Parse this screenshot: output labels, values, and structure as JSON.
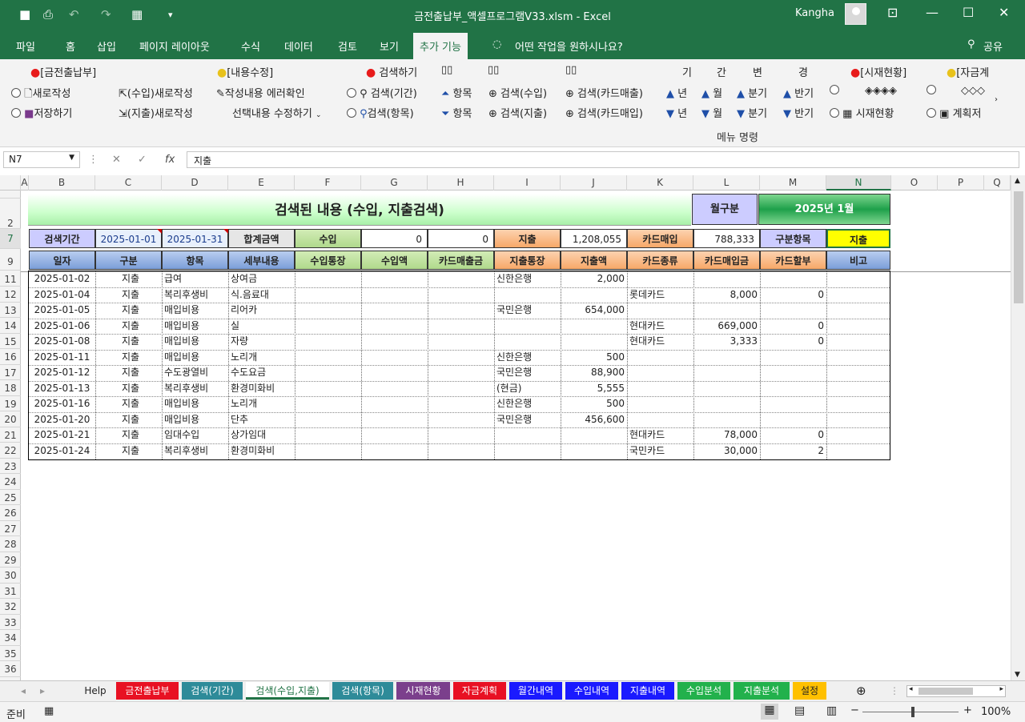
{
  "window": {
    "title": "금전출납부_액셀프로그램V33.xlsm  -  Excel",
    "user": "Kangha"
  },
  "ribbon_tabs": [
    "파일",
    "홈",
    "삽입",
    "페이지 레이아웃",
    "수식",
    "데이터",
    "검토",
    "보기",
    "추가 기능",
    "어떤 작업을 원하시나요?",
    "공유"
  ],
  "ribbon": {
    "group1_title": "[금전출납부]",
    "new": "새로작성",
    "save": "저장하기",
    "income_new": "(수입)새로작성",
    "expense_new": "(지출)새로작성",
    "group2_title": "[내용수정]",
    "error_check": "작성내용 에러확인",
    "edit_selected": "선택내용 수정하기",
    "search_title": "검색하기",
    "search_period": "검색(기간)",
    "search_item": "검색(항목)",
    "item_up": "항목",
    "item_down": "항목",
    "search_income": "검색(수입)",
    "search_expense": "검색(지출)",
    "search_card_sales": "검색(카드매출)",
    "search_card_buy": "검색(카드매입)",
    "period_header": [
      "기",
      "간",
      "변",
      "경"
    ],
    "year": "년",
    "month": "월",
    "quarter": "분기",
    "half": "반기",
    "status_title": "[시재현황]",
    "diamonds": "◈◈◈◈",
    "status": "시재현황",
    "plan_title": "[자금계",
    "diamonds2": "◇◇◇",
    "plan": "계획저",
    "menu_label": "메뉴 명령"
  },
  "formula_bar": {
    "name_box": "N7",
    "formula": "지출"
  },
  "columns": [
    "A",
    "B",
    "C",
    "D",
    "E",
    "F",
    "G",
    "H",
    "I",
    "J",
    "K",
    "L",
    "M",
    "N",
    "O",
    "P",
    "Q"
  ],
  "rows": [
    "1",
    "2",
    "7",
    "9",
    "11",
    "12",
    "13",
    "14",
    "15",
    "16",
    "17",
    "18",
    "19",
    "20",
    "21",
    "22",
    "23",
    "24",
    "25",
    "26",
    "27",
    "28",
    "29",
    "30",
    "31",
    "32",
    "33",
    "34",
    "35",
    "36"
  ],
  "sheet": {
    "title": "검색된 내용 (수입, 지출검색)",
    "month_label": "월구분",
    "month_value": "2025년 1월",
    "search_period_label": "검색기간",
    "date_from": "2025-01-01",
    "date_to": "2025-01-31",
    "total_label": "합계금액",
    "income_label": "수입",
    "income_value": "0",
    "income_value2": "0",
    "expense_label": "지출",
    "expense_value": "1,208,055",
    "card_buy_label": "카드매입",
    "card_buy_value": "788,333",
    "category_label": "구분항목",
    "category_value": "지출",
    "headers": [
      "일자",
      "구분",
      "항목",
      "세부내용",
      "수입통장",
      "수입액",
      "카드매출금",
      "지출통장",
      "지출액",
      "카드종류",
      "카드매입금",
      "카드할부",
      "비고"
    ],
    "data": [
      [
        "2025-01-02",
        "지출",
        "급여",
        "상여금",
        "",
        "",
        "",
        "신한은행",
        "2,000",
        "",
        "",
        "",
        ""
      ],
      [
        "2025-01-04",
        "지출",
        "복리후생비",
        "식.음료대",
        "",
        "",
        "",
        "",
        "",
        "롯데카드",
        "8,000",
        "0",
        ""
      ],
      [
        "2025-01-05",
        "지출",
        "매입비용",
        "리어카",
        "",
        "",
        "",
        "국민은행",
        "654,000",
        "",
        "",
        "",
        ""
      ],
      [
        "2025-01-06",
        "지출",
        "매입비용",
        "실",
        "",
        "",
        "",
        "",
        "",
        "현대카드",
        "669,000",
        "0",
        ""
      ],
      [
        "2025-01-08",
        "지출",
        "매입비용",
        "자량",
        "",
        "",
        "",
        "",
        "",
        "현대카드",
        "3,333",
        "0",
        ""
      ],
      [
        "2025-01-11",
        "지출",
        "매입비용",
        "노리개",
        "",
        "",
        "",
        "신한은행",
        "500",
        "",
        "",
        "",
        ""
      ],
      [
        "2025-01-12",
        "지출",
        "수도광열비",
        "수도요금",
        "",
        "",
        "",
        "국민은행",
        "88,900",
        "",
        "",
        "",
        ""
      ],
      [
        "2025-01-13",
        "지출",
        "복리후생비",
        "환경미화비",
        "",
        "",
        "",
        "(현금)",
        "5,555",
        "",
        "",
        "",
        ""
      ],
      [
        "2025-01-16",
        "지출",
        "매입비용",
        "노리개",
        "",
        "",
        "",
        "신한은행",
        "500",
        "",
        "",
        "",
        ""
      ],
      [
        "2025-01-20",
        "지출",
        "매입비용",
        "단추",
        "",
        "",
        "",
        "국민은행",
        "456,600",
        "",
        "",
        "",
        ""
      ],
      [
        "2025-01-21",
        "지출",
        "임대수입",
        "상가임대",
        "",
        "",
        "",
        "",
        "",
        "현대카드",
        "78,000",
        "0",
        ""
      ],
      [
        "2025-01-24",
        "지출",
        "복리후생비",
        "환경미화비",
        "",
        "",
        "",
        "",
        "",
        "국민카드",
        "30,000",
        "2",
        ""
      ]
    ]
  },
  "sheet_tabs": [
    {
      "label": "Help",
      "color": "#f0f0f0",
      "text": "#222"
    },
    {
      "label": "금전출납부",
      "color": "#e81123",
      "text": "#fff"
    },
    {
      "label": "검색(기간)",
      "color": "#2e8b99",
      "text": "#fff"
    },
    {
      "label": "검색(수입,지출)",
      "color": "#ffffff",
      "text": "#217346"
    },
    {
      "label": "검색(항목)",
      "color": "#2e8b99",
      "text": "#fff"
    },
    {
      "label": "시재현황",
      "color": "#7b3f8c",
      "text": "#fff"
    },
    {
      "label": "자금계획",
      "color": "#e81123",
      "text": "#fff"
    },
    {
      "label": "월간내역",
      "color": "#1a1aff",
      "text": "#fff"
    },
    {
      "label": "수입내역",
      "color": "#1a1aff",
      "text": "#fff"
    },
    {
      "label": "지출내역",
      "color": "#1a1aff",
      "text": "#fff"
    },
    {
      "label": "수입분석",
      "color": "#22b14c",
      "text": "#fff"
    },
    {
      "label": "지출분석",
      "color": "#22b14c",
      "text": "#fff"
    },
    {
      "label": "설정",
      "color": "#ffc000",
      "text": "#222"
    }
  ],
  "status": {
    "ready": "준비",
    "zoom": "100%"
  }
}
